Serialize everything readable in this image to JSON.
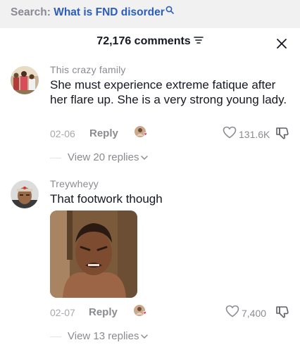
{
  "search": {
    "prefix": "Search:",
    "query": "What is FND disorder"
  },
  "header": {
    "comments_count": "72,176 comments"
  },
  "comments": [
    {
      "username": "This crazy family",
      "text": "She must experience extreme fatique after her flare up. She is a very strong young lady.",
      "date": "02-06",
      "reply_label": "Reply",
      "likes": "131.6K",
      "view_replies": "View 20 replies"
    },
    {
      "username": "Treywheyy",
      "text": "That footwork though",
      "date": "02-07",
      "reply_label": "Reply",
      "likes": "7,400",
      "view_replies": "View 13 replies"
    }
  ],
  "icons": {
    "search": "search-icon",
    "sort": "sort-icon",
    "close": "close-icon",
    "like": "heart-outline-icon",
    "dislike": "thumbs-down-icon",
    "chevron": "chevron-down-icon"
  },
  "colors": {
    "search_query": "#2b5db9",
    "muted_text": "#8a8b91",
    "primary_text": "#161823",
    "creator_heart": "#fe2c55"
  }
}
